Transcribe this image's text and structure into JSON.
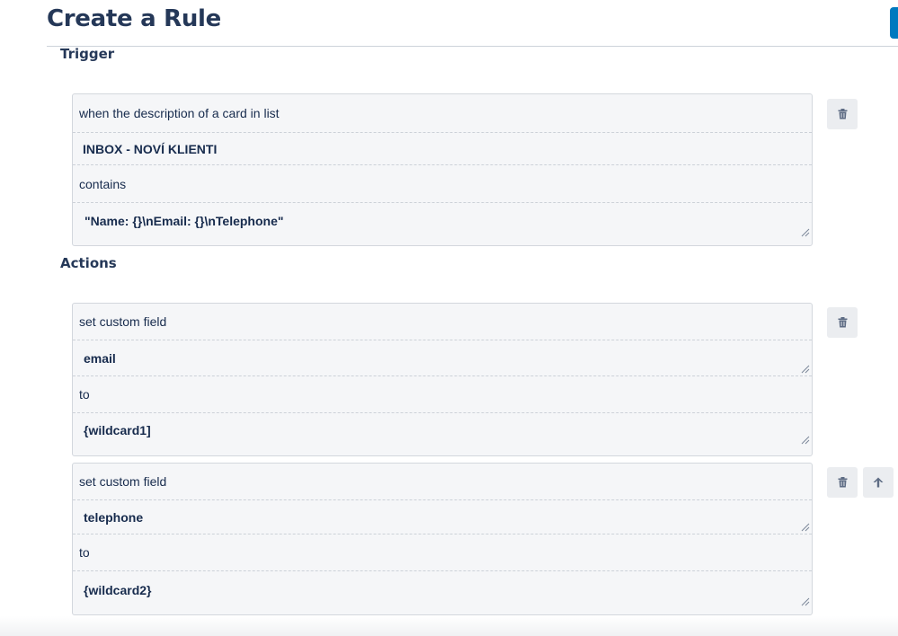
{
  "page": {
    "title": "Create a Rule"
  },
  "trigger": {
    "heading": "Trigger",
    "rows": [
      "when the description of a card in list",
      "INBOX - NOVÍ KLIENTI",
      "contains",
      "\"Name: {}\\nEmail: {}\\nTelephone\""
    ]
  },
  "actions": {
    "heading": "Actions",
    "items": [
      {
        "rows": [
          "set custom field",
          "email",
          "to",
          "{wildcard1]"
        ]
      },
      {
        "rows": [
          "set custom field",
          "telephone",
          "to",
          "{wildcard2}"
        ]
      }
    ]
  },
  "icons": {
    "delete": "trash-icon",
    "move_up": "arrow-up-icon",
    "resize": "resize-grip-icon"
  },
  "colors": {
    "title": "#253858",
    "accent_button": "#0079bf",
    "box_background": "#f5f6f8",
    "icon_button_background": "#ebedf0"
  }
}
